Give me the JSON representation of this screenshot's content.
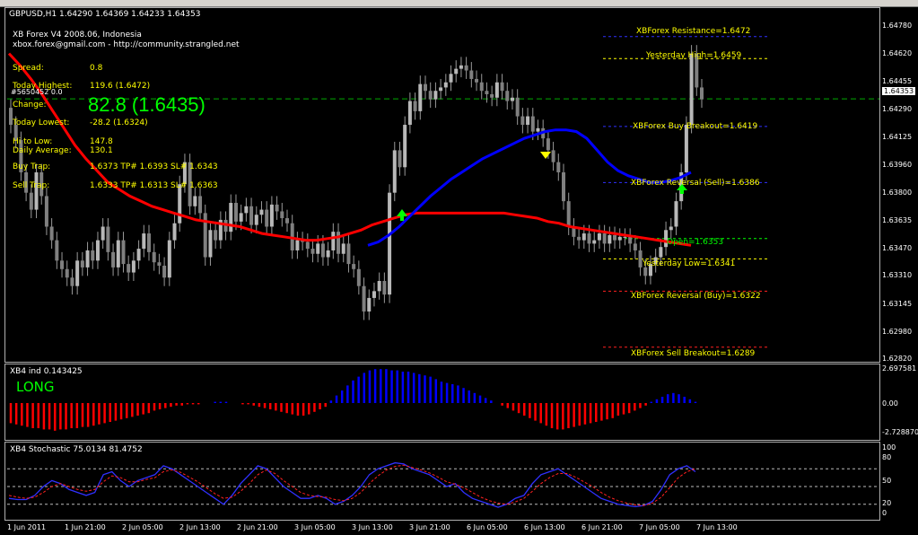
{
  "title": "GBPUSD,H1  1.64290 1.64369 1.64233 1.64353",
  "info": {
    "line1": "XB Forex V4 2008.06, Indonesia",
    "line2": "xbox.forex@gmail.com  -  http://community.strangled.net",
    "spread_label": "Spread:",
    "spread_value": "0.8",
    "highest_label": "Today Highest:",
    "highest_value": "119.6  (1.6472)",
    "change_label": "Change:",
    "change_value": "82.8   (1.6435)",
    "lowest_label": "Today Lowest:",
    "lowest_value": "-28.2  (1.6324)",
    "hilo_label": "Hi to Low:",
    "hilo_value": "147.8",
    "avg_label": "Daily Average:",
    "avg_value": "130.1",
    "buy_label": "Buy Trap:",
    "buy_value": "1.6373 TP# 1.6393 SL# 1.6343",
    "sell_label": "Sell Trap:",
    "sell_value": "1.6333 TP# 1.6313 SL# 1.6363",
    "overlap": "#5650452 0.0"
  },
  "level_labels": {
    "resistance": "XBForex Resistance=1.6472",
    "yhigh": "Yesterday High=1.6459",
    "buy_breakout": "XBForex Buy Breakout=1.6419",
    "rev_sell": "XBForex Reversal (Sell)=1.6386",
    "open": "Open=1.6353",
    "ylow": "Yesterday Low=1.6341",
    "rev_buy": "XBForex Reversal (Buy)=1.6322",
    "sell_breakout": "XBForex Sell Breakout=1.6289"
  },
  "indicator": {
    "title": "XB4 ind 0.143425",
    "signal": "LONG"
  },
  "stochastic": {
    "title": "XB4 Stochastic 75.0134 81.4752"
  },
  "current_price": "1.64353",
  "price_ticks": [
    "1.64780",
    "1.64620",
    "1.64455",
    "1.64290",
    "1.64125",
    "1.63960",
    "1.63800",
    "1.63635",
    "1.63470",
    "1.63310",
    "1.63145",
    "1.62980",
    "1.62820"
  ],
  "ind_ticks": [
    "2.697581",
    "0.00",
    "-2.728870"
  ],
  "stoch_ticks": [
    "100",
    "80",
    "50",
    "20",
    "0"
  ],
  "time_ticks": [
    "1 Jun 2011",
    "1 Jun 21:00",
    "2 Jun 05:00",
    "2 Jun 13:00",
    "2 Jun 21:00",
    "3 Jun 05:00",
    "3 Jun 13:00",
    "3 Jun 21:00",
    "6 Jun 05:00",
    "6 Jun 13:00",
    "6 Jun 21:00",
    "7 Jun 05:00",
    "7 Jun 13:00"
  ],
  "colors": {
    "bull": "#b8b8b8",
    "bear": "#808080",
    "ma_red": "#ff0000",
    "ma_blue": "#0000ff",
    "level": "#ffff00",
    "level_green": "#00ff00",
    "level_blue": "#3030ff"
  },
  "chart_data": {
    "type": "candlestick",
    "ylim": [
      1.6282,
      1.6484
    ],
    "candle_closes": [
      1.642,
      1.6411,
      1.6392,
      1.638,
      1.637,
      1.6392,
      1.6378,
      1.636,
      1.6352,
      1.634,
      1.6335,
      1.633,
      1.6325,
      1.634,
      1.6336,
      1.6346,
      1.634,
      1.6352,
      1.636,
      1.6345,
      1.6336,
      1.6352,
      1.6338,
      1.6333,
      1.634,
      1.6347,
      1.6356,
      1.6345,
      1.6339,
      1.6337,
      1.633,
      1.6352,
      1.6362,
      1.6385,
      1.6398,
      1.6372,
      1.6378,
      1.6368,
      1.6342,
      1.6358,
      1.6352,
      1.6364,
      1.6357,
      1.6374,
      1.6363,
      1.6368,
      1.6372,
      1.6361,
      1.6367,
      1.637,
      1.636,
      1.6373,
      1.6369,
      1.6365,
      1.6362,
      1.6346,
      1.6352,
      1.6351,
      1.6347,
      1.6344,
      1.635,
      1.6342,
      1.6346,
      1.6357,
      1.6344,
      1.635,
      1.6338,
      1.6335,
      1.6325,
      1.631,
      1.6318,
      1.6322,
      1.6328,
      1.632,
      1.638,
      1.6405,
      1.6395,
      1.642,
      1.6434,
      1.6428,
      1.6444,
      1.644,
      1.6435,
      1.644,
      1.6442,
      1.6445,
      1.645,
      1.6453,
      1.6455,
      1.6452,
      1.6447,
      1.6445,
      1.644,
      1.6438,
      1.6436,
      1.6445,
      1.644,
      1.6434,
      1.6436,
      1.6425,
      1.642,
      1.6425,
      1.6416,
      1.6418,
      1.6412,
      1.6405,
      1.6398,
      1.6392,
      1.6375,
      1.636,
      1.6354,
      1.6352,
      1.6356,
      1.635,
      1.6352,
      1.6356,
      1.635,
      1.6355,
      1.6352,
      1.6354,
      1.6354,
      1.635,
      1.6346,
      1.6336,
      1.6331,
      1.6338,
      1.6342,
      1.6348,
      1.6358,
      1.636,
      1.6375,
      1.6392,
      1.642,
      1.6462,
      1.6442,
      1.6435
    ],
    "ma_red": [
      1.6462,
      1.6455,
      1.6447,
      1.6438,
      1.6428,
      1.6418,
      1.6408,
      1.64,
      1.6393,
      1.6386,
      1.6382,
      1.6378,
      1.6375,
      1.6372,
      1.637,
      1.6368,
      1.6366,
      1.6364,
      1.6363,
      1.6362,
      1.6361,
      1.636,
      1.6358,
      1.6356,
      1.6355,
      1.6354,
      1.6353,
      1.6352,
      1.6352,
      1.6353,
      1.6354,
      1.6356,
      1.6358,
      1.6361,
      1.6363,
      1.6365,
      1.6367,
      1.6368,
      1.6368,
      1.6368,
      1.6368,
      1.6368,
      1.6368,
      1.6368,
      1.6368,
      1.6368,
      1.6367,
      1.6366,
      1.6365,
      1.6363,
      1.6362,
      1.636,
      1.6359,
      1.6358,
      1.6357,
      1.6356,
      1.6355,
      1.6354,
      1.6353,
      1.6352,
      1.6351,
      1.635,
      1.6349
    ],
    "ma_blue": [
      1.6349,
      1.6351,
      1.6355,
      1.636,
      1.6366,
      1.6372,
      1.6378,
      1.6383,
      1.6388,
      1.6392,
      1.6396,
      1.64,
      1.6403,
      1.6406,
      1.6409,
      1.6412,
      1.6414,
      1.6416,
      1.6417,
      1.6417,
      1.6416,
      1.6412,
      1.6405,
      1.6398,
      1.6393,
      1.639,
      1.6388,
      1.6386,
      1.6386,
      1.6387,
      1.6389,
      1.6392
    ],
    "levels": [
      1.6472,
      1.6459,
      1.6419,
      1.6386,
      1.6353,
      1.6341,
      1.6322,
      1.6289
    ],
    "indicator_values": [
      -1.6,
      -1.7,
      -1.8,
      -1.9,
      -2.0,
      -2.0,
      -2.1,
      -2.1,
      -2.2,
      -2.1,
      -2.1,
      -2.0,
      -2.0,
      -1.9,
      -1.9,
      -1.8,
      -1.7,
      -1.6,
      -1.5,
      -1.4,
      -1.3,
      -1.2,
      -1.1,
      -1.0,
      -0.9,
      -0.8,
      -0.6,
      -0.5,
      -0.4,
      -0.3,
      -0.2,
      -0.2,
      -0.1,
      -0.1,
      -0.1,
      0,
      0,
      0.1,
      0.1,
      0.1,
      0,
      0,
      -0.1,
      -0.1,
      -0.2,
      -0.3,
      -0.4,
      -0.5,
      -0.6,
      -0.7,
      -0.8,
      -0.9,
      -1.0,
      -1.0,
      -0.9,
      -0.7,
      -0.5,
      -0.3,
      0.2,
      0.6,
      1.0,
      1.4,
      1.8,
      2.1,
      2.4,
      2.6,
      2.7,
      2.7,
      2.7,
      2.6,
      2.6,
      2.5,
      2.5,
      2.4,
      2.3,
      2.2,
      2.1,
      1.9,
      1.7,
      1.6,
      1.5,
      1.4,
      1.2,
      1.0,
      0.8,
      0.6,
      0.4,
      0.2,
      0,
      -0.2,
      -0.4,
      -0.6,
      -0.8,
      -1.0,
      -1.2,
      -1.4,
      -1.6,
      -1.8,
      -2.0,
      -2.1,
      -2.1,
      -2.0,
      -1.9,
      -1.8,
      -1.7,
      -1.6,
      -1.5,
      -1.4,
      -1.3,
      -1.2,
      -1.0,
      -0.9,
      -0.8,
      -0.6,
      -0.4,
      -0.2,
      0.1,
      0.3,
      0.5,
      0.7,
      0.8,
      0.7,
      0.5,
      0.3,
      0.1
    ],
    "stoch_k": [
      30,
      28,
      28,
      35,
      50,
      60,
      55,
      45,
      40,
      35,
      40,
      70,
      75,
      60,
      50,
      60,
      65,
      70,
      85,
      80,
      70,
      60,
      50,
      40,
      30,
      20,
      35,
      55,
      70,
      85,
      80,
      65,
      50,
      40,
      30,
      30,
      35,
      30,
      20,
      25,
      35,
      50,
      70,
      80,
      85,
      90,
      88,
      80,
      75,
      70,
      60,
      50,
      55,
      40,
      30,
      25,
      20,
      15,
      20,
      30,
      35,
      55,
      70,
      75,
      80,
      70,
      60,
      50,
      40,
      30,
      25,
      20,
      18,
      16,
      18,
      25,
      45,
      70,
      80,
      85,
      75
    ],
    "stoch_d": [
      35,
      32,
      30,
      32,
      40,
      50,
      55,
      50,
      45,
      42,
      45,
      58,
      68,
      65,
      58,
      58,
      62,
      65,
      75,
      78,
      74,
      66,
      58,
      48,
      38,
      30,
      32,
      42,
      55,
      70,
      78,
      72,
      60,
      50,
      40,
      35,
      33,
      32,
      28,
      26,
      30,
      40,
      55,
      68,
      78,
      84,
      86,
      82,
      78,
      73,
      66,
      58,
      54,
      48,
      40,
      32,
      26,
      22,
      20,
      24,
      30,
      42,
      55,
      65,
      72,
      72,
      66,
      58,
      50,
      40,
      32,
      26,
      22,
      19,
      18,
      22,
      32,
      48,
      65,
      75,
      80
    ]
  }
}
